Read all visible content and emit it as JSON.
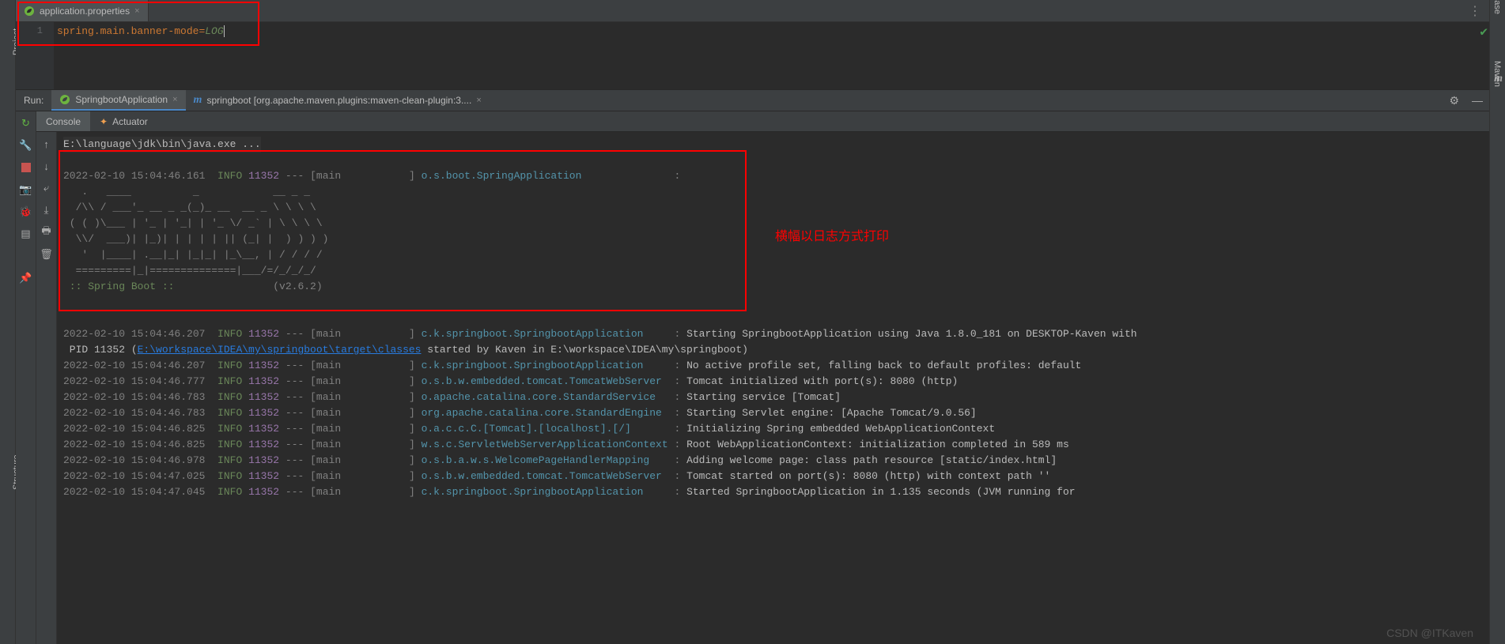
{
  "left_sidebar": {
    "project": "Project",
    "structure": "Structure"
  },
  "right_sidebar": {
    "database": "Database",
    "maven": "Maven"
  },
  "editor": {
    "tab_label": "application.properties",
    "line_no": "1",
    "key": "spring.main.banner-mode",
    "value": "LOG"
  },
  "run": {
    "label": "Run:",
    "tabs": {
      "app": "SpringbootApplication",
      "maven": "springboot [org.apache.maven.plugins:maven-clean-plugin:3...."
    },
    "subtabs": {
      "console": "Console",
      "actuator": "Actuator"
    }
  },
  "console_cmd": "E:\\language\\jdk\\bin\\java.exe ...",
  "banner": {
    "l1": "   .   ____          _            __ _ _",
    "l2": "  /\\\\ / ___'_ __ _ _(_)_ __  __ _ \\ \\ \\ \\",
    "l3": " ( ( )\\___ | '_ | '_| | '_ \\/ _` | \\ \\ \\ \\",
    "l4": "  \\\\/  ___)| |_)| | | | | || (_| |  ) ) ) )",
    "l5": "   '  |____| .__|_| |_|_| |_\\__, | / / / /",
    "l6": "  =========|_|==============|___/=/_/_/_/",
    "name": " :: Spring Boot :: ",
    "ver": "               (v2.6.2)"
  },
  "log0": {
    "ts": "2022-02-10 15:04:46.161",
    "lvl": "INFO",
    "pid": "11352",
    "thr": "main",
    "logger": "o.s.boot.SpringApplication",
    "msg": ""
  },
  "logs": [
    {
      "ts": "2022-02-10 15:04:46.207",
      "lvl": "INFO",
      "pid": "11352",
      "thr": "main",
      "logger": "c.k.springboot.SpringbootApplication",
      "msg": "Starting SpringbootApplication using Java 1.8.0_181 on DESKTOP-Kaven with"
    },
    {
      "ts": "2022-02-10 15:04:46.207",
      "lvl": "INFO",
      "pid": "11352",
      "thr": "main",
      "logger": "c.k.springboot.SpringbootApplication",
      "msg": "No active profile set, falling back to default profiles: default"
    },
    {
      "ts": "2022-02-10 15:04:46.777",
      "lvl": "INFO",
      "pid": "11352",
      "thr": "main",
      "logger": "o.s.b.w.embedded.tomcat.TomcatWebServer",
      "msg": "Tomcat initialized with port(s): 8080 (http)"
    },
    {
      "ts": "2022-02-10 15:04:46.783",
      "lvl": "INFO",
      "pid": "11352",
      "thr": "main",
      "logger": "o.apache.catalina.core.StandardService",
      "msg": "Starting service [Tomcat]"
    },
    {
      "ts": "2022-02-10 15:04:46.783",
      "lvl": "INFO",
      "pid": "11352",
      "thr": "main",
      "logger": "org.apache.catalina.core.StandardEngine",
      "msg": "Starting Servlet engine: [Apache Tomcat/9.0.56]"
    },
    {
      "ts": "2022-02-10 15:04:46.825",
      "lvl": "INFO",
      "pid": "11352",
      "thr": "main",
      "logger": "o.a.c.c.C.[Tomcat].[localhost].[/]",
      "msg": "Initializing Spring embedded WebApplicationContext"
    },
    {
      "ts": "2022-02-10 15:04:46.825",
      "lvl": "INFO",
      "pid": "11352",
      "thr": "main",
      "logger": "w.s.c.ServletWebServerApplicationContext",
      "msg": "Root WebApplicationContext: initialization completed in 589 ms"
    },
    {
      "ts": "2022-02-10 15:04:46.978",
      "lvl": "INFO",
      "pid": "11352",
      "thr": "main",
      "logger": "o.s.b.a.w.s.WelcomePageHandlerMapping",
      "msg": "Adding welcome page: class path resource [static/index.html]"
    },
    {
      "ts": "2022-02-10 15:04:47.025",
      "lvl": "INFO",
      "pid": "11352",
      "thr": "main",
      "logger": "o.s.b.w.embedded.tomcat.TomcatWebServer",
      "msg": "Tomcat started on port(s): 8080 (http) with context path ''"
    },
    {
      "ts": "2022-02-10 15:04:47.045",
      "lvl": "INFO",
      "pid": "11352",
      "thr": "main",
      "logger": "c.k.springboot.SpringbootApplication",
      "msg": "Started SpringbootApplication in 1.135 seconds (JVM running for"
    }
  ],
  "log_pid_line": {
    "prefix": " PID 11352 (",
    "link": "E:\\workspace\\IDEA\\my\\springboot\\target\\classes",
    "suffix": " started by Kaven in E:\\workspace\\IDEA\\my\\springboot)"
  },
  "annotation": "横幅以日志方式打印",
  "watermark": "CSDN @ITKaven"
}
